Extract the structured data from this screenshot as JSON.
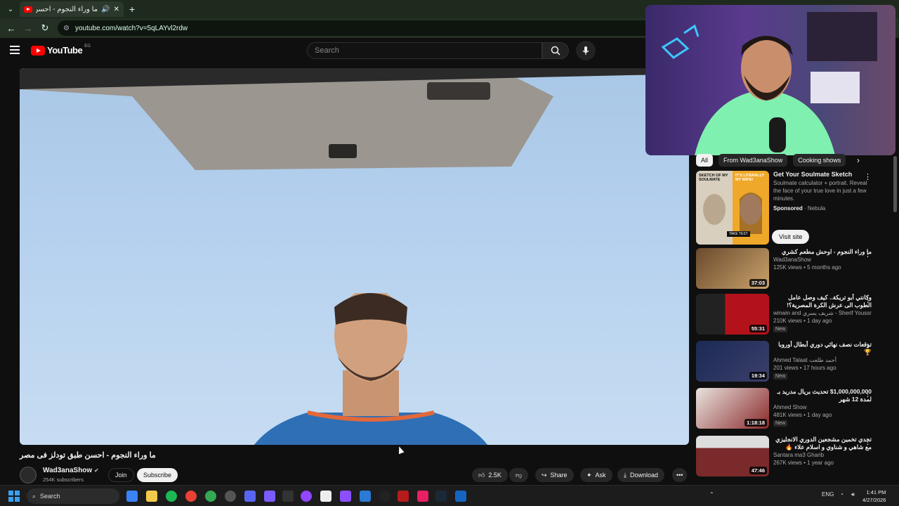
{
  "browser": {
    "tab_title": "ما وراء النجوم - احسن طبق تودلز في...",
    "url": "youtube.com/watch?v=5qLAYvl2rdw"
  },
  "youtube": {
    "logo_text": "YouTube",
    "region": "EG",
    "search_placeholder": "Search"
  },
  "video": {
    "title": "ما وراء النجوم - احسن طبق تودلز فى مصر",
    "channel": "Wad3anaShow",
    "subscribers": "254K subscribers",
    "join_label": "Join",
    "subscribe_label": "Subscribe",
    "likes": "2.5K",
    "share_label": "Share",
    "ask_label": "Ask",
    "download_label": "Download"
  },
  "chips": [
    "All",
    "From Wad3anaShow",
    "Cooking shows"
  ],
  "ad": {
    "title": "Get Your Soulmate Sketch",
    "description": "Soulmate calculator + portrait. Reveal the face of your true love in just a few minutes.",
    "sponsored": "Sponsored",
    "advertiser": "Nebula",
    "visit_label": "Visit site",
    "thumb_left_text": "SKETCH OF MY SOULMATE",
    "thumb_right_text": "IT'S LITERALLY MY WIFE!",
    "thumb_button": "TAKE TEST"
  },
  "recommendations": [
    {
      "title": "ما وراء النجوم - اوحش مطعم كشري",
      "channel": "Wad3anaShow",
      "meta": "125K views • 5 months ago",
      "duration": "37:03",
      "new": ""
    },
    {
      "title": "وكانتي أبو تريكة.. كيف وصل عامل الطوب الى عرش الكرة المصرية؟!",
      "channel": "winwin and شريف يسري - Sherif Youssri",
      "meta": "210K views • 1 day ago",
      "duration": "55:31",
      "new": "New"
    },
    {
      "title": "توقعات نصف نهائي دوري أبطال أوروبا 🏆",
      "channel": "Ahmed Talaat أحمد طلعت",
      "meta": "201 views • 17 hours ago",
      "duration": "19:34",
      "new": "New"
    },
    {
      "title": "$1,000,000,000 تحديث بريال مدريد بـ لمدة 12 شهر",
      "channel": "Ahmed Show",
      "meta": "481K views • 1 day ago",
      "duration": "1:18:18",
      "new": "New"
    },
    {
      "title": "تحدي تخمين مشجعين الدوري الانجليزي مع شاهي و شناوي و اسلام علاء 🔥",
      "channel": "Santara ma3 Gharib",
      "meta": "267K views • 1 year ago",
      "duration": "47:46",
      "new": ""
    }
  ],
  "taskbar": {
    "search_label": "Search",
    "lang": "ENG",
    "time": "1:41 PM",
    "date": "4/27/2026"
  }
}
